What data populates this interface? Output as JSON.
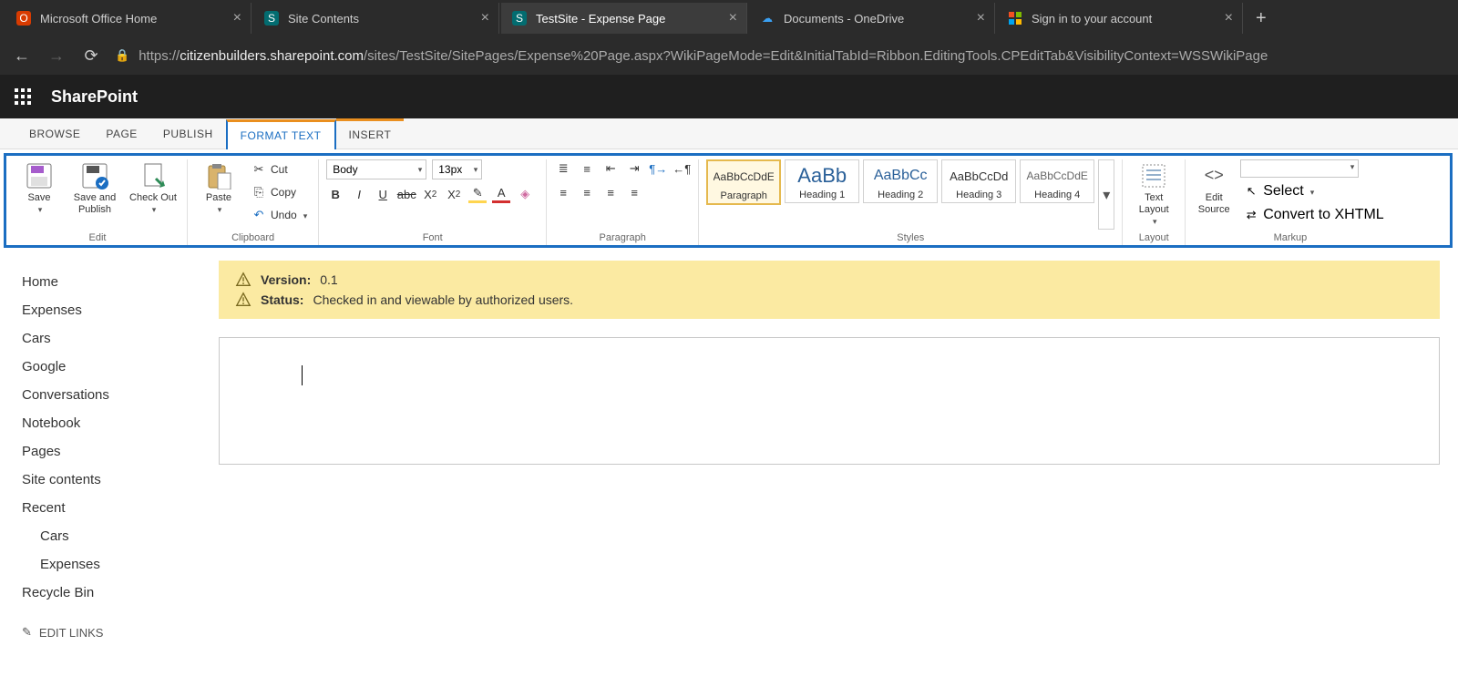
{
  "browser": {
    "tabs": [
      {
        "title": "Microsoft Office Home",
        "favicon_bg": "#d83b01",
        "favicon_text": "O"
      },
      {
        "title": "Site Contents",
        "favicon_bg": "#036c70",
        "favicon_text": "S"
      },
      {
        "title": "TestSite - Expense Page",
        "favicon_bg": "#036c70",
        "favicon_text": "S",
        "active": true
      },
      {
        "title": "Documents - OneDrive",
        "favicon_bg": "#0078d4",
        "favicon_text": "☁"
      },
      {
        "title": "Sign in to your account",
        "favicon_bg": "transparent",
        "favicon_text": "⊞"
      }
    ],
    "url_prefix": "https://",
    "url_host": "citizenbuilders.sharepoint.com",
    "url_path": "/sites/TestSite/SitePages/Expense%20Page.aspx?WikiPageMode=Edit&InitialTabId=Ribbon.EditingTools.CPEditTab&VisibilityContext=WSSWikiPage"
  },
  "suite": {
    "title": "SharePoint"
  },
  "ribbon_tabs": {
    "browse": "BROWSE",
    "page": "PAGE",
    "publish": "PUBLISH",
    "format_text": "FORMAT TEXT",
    "insert": "INSERT"
  },
  "ribbon": {
    "edit": {
      "save": "Save",
      "save_publish": "Save and Publish",
      "check_out": "Check Out",
      "group": "Edit"
    },
    "clipboard": {
      "paste": "Paste",
      "cut": "Cut",
      "copy": "Copy",
      "undo": "Undo",
      "group": "Clipboard"
    },
    "font": {
      "font_name": "Body",
      "font_size": "13px",
      "group": "Font"
    },
    "paragraph": {
      "group": "Paragraph"
    },
    "styles": {
      "items": [
        {
          "sample": "AaBbCcDdE",
          "label": "Paragraph",
          "sample_style": "font-size:12px;"
        },
        {
          "sample": "AaBb",
          "label": "Heading 1",
          "sample_style": "font-size:22px;color:#2a6099;"
        },
        {
          "sample": "AaBbCc",
          "label": "Heading 2",
          "sample_style": "font-size:16px;color:#2a6099;"
        },
        {
          "sample": "AaBbCcDd",
          "label": "Heading 3",
          "sample_style": "font-size:13px;"
        },
        {
          "sample": "AaBbCcDdE",
          "label": "Heading 4",
          "sample_style": "font-size:12px;color:#666;"
        }
      ],
      "group": "Styles"
    },
    "layout": {
      "text_layout": "Text Layout",
      "group": "Layout"
    },
    "markup": {
      "edit_source": "Edit Source",
      "select": "Select",
      "convert": "Convert to XHTML",
      "group": "Markup"
    }
  },
  "quick_launch": {
    "items": [
      "Home",
      "Expenses",
      "Cars",
      "Google",
      "Conversations",
      "Notebook",
      "Pages",
      "Site contents"
    ],
    "recent_header": "Recent",
    "recent": [
      "Cars",
      "Expenses"
    ],
    "recycle": "Recycle Bin",
    "edit_links": "EDIT LINKS"
  },
  "status": {
    "version_label": "Version:",
    "version_value": "0.1",
    "status_label": "Status:",
    "status_value": "Checked in and viewable by authorized users."
  }
}
